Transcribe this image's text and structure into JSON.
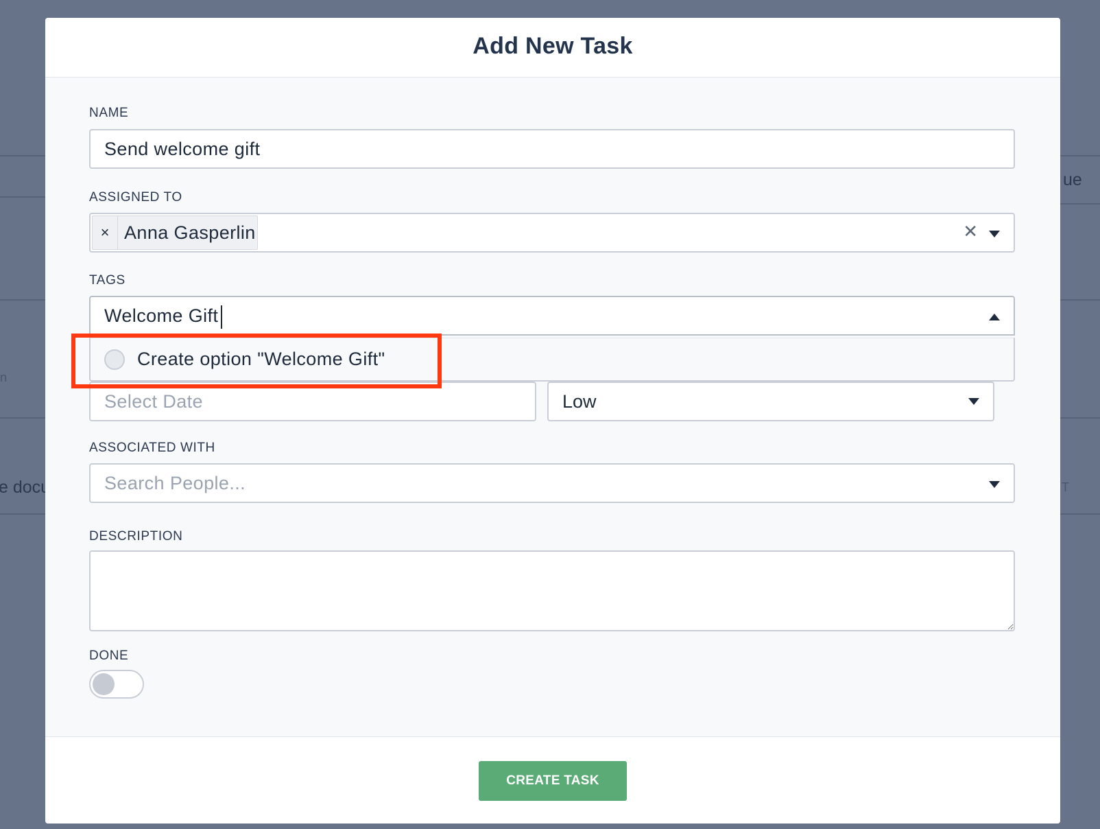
{
  "background": {
    "fragment_right": "ue",
    "fragment_left": "e docu",
    "fragment_left_small": "n",
    "fragment_right_small": "T"
  },
  "modal": {
    "title": "Add New Task",
    "fields": {
      "name": {
        "label": "NAME",
        "value": "Send welcome gift"
      },
      "assigned_to": {
        "label": "ASSIGNED TO",
        "chips": [
          {
            "label": "Anna Gasperlin",
            "remove": "×"
          }
        ],
        "clear": "✕"
      },
      "tags": {
        "label": "TAGS",
        "value": "Welcome Gift",
        "dropdown_open": true,
        "options": [
          {
            "label": "Create option \"Welcome Gift\""
          }
        ]
      },
      "due_date": {
        "placeholder": "Select Date"
      },
      "priority": {
        "value": "Low"
      },
      "associated_with": {
        "label": "ASSOCIATED WITH",
        "placeholder": "Search People..."
      },
      "description": {
        "label": "DESCRIPTION",
        "value": ""
      },
      "done": {
        "label": "DONE",
        "checked": false
      }
    },
    "submit_label": "CREATE TASK"
  },
  "colors": {
    "overlay": "#667389",
    "primary_button": "#5aab76",
    "highlight_box": "#ff3a12",
    "title_text": "#24344d"
  },
  "icons": {
    "chip_remove": "close-icon",
    "clear": "close-icon",
    "dropdown": "caret-down-icon",
    "dropdown_open": "caret-up-icon",
    "option_radio": "radio-icon"
  }
}
